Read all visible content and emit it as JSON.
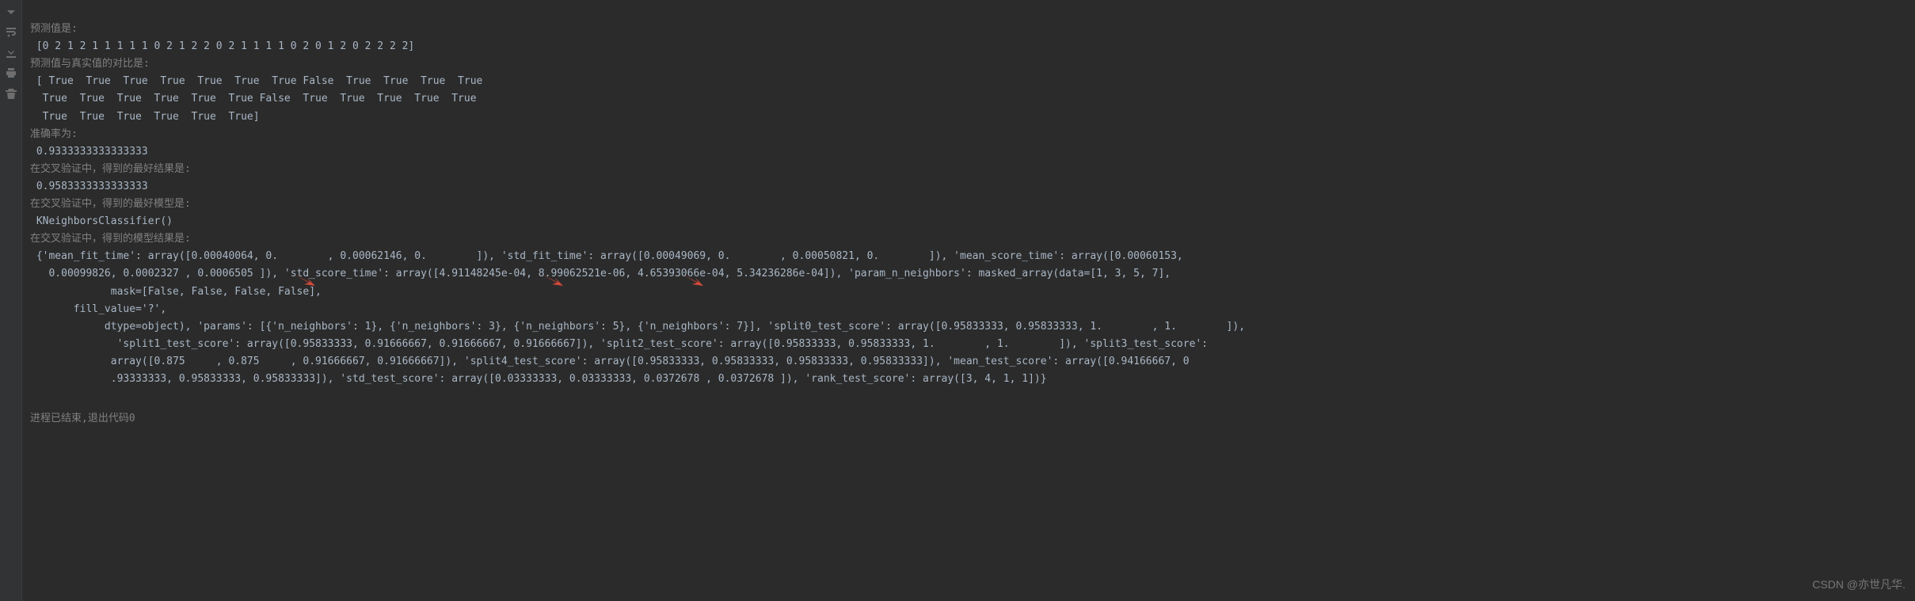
{
  "gutter": {
    "icons": [
      "arrow-down-icon",
      "wrap-icon",
      "download-icon",
      "print-icon",
      "trash-icon"
    ]
  },
  "labels": {
    "pred_header": "预测值是:",
    "pred_values": " [0 2 1 2 1 1 1 1 1 0 2 1 2 2 0 2 1 1 1 1 0 2 0 1 2 0 2 2 2 2]",
    "compare_header": "预测值与真实值的对比是:",
    "compare_row_1": " [ True  True  True  True  True  True  True False  True  True  True  True",
    "compare_row_2": "  True  True  True  True  True  True False  True  True  True  True  True",
    "compare_row_3": "  True  True  True  True  True  True]",
    "accuracy_header": "准确率为:",
    "accuracy_value": " 0.9333333333333333",
    "cv_best_result_header": "在交叉验证中，得到的最好结果是:",
    "cv_best_result_value": " 0.9583333333333333",
    "cv_best_model_header": "在交叉验证中，得到的最好模型是:",
    "cv_best_model_value": " KNeighborsClassifier()",
    "cv_model_results_header": "在交叉验证中，得到的模型结果是:",
    "cv_results_line_1": " {'mean_fit_time': array([0.00040064, 0.        , 0.00062146, 0.        ]), 'std_fit_time': array([0.00049069, 0.        , 0.00050821, 0.        ]), 'mean_score_time': array([0.00060153,",
    "cv_results_line_2": "   0.00099826, 0.0002327 , 0.0006505 ]), 'std_score_time': array([4.91148245e-04, 8.99062521e-06, 4.65393066e-04, 5.34236286e-04]), 'param_n_neighbors': masked_array(data=[1, 3, 5, 7],",
    "cv_results_line_3": "             mask=[False, False, False, False],",
    "cv_results_line_4": "       fill_value='?',",
    "cv_results_line_5": "            dtype=object), 'params': [{'n_neighbors': 1}, {'n_neighbors': 3}, {'n_neighbors': 5}, {'n_neighbors': 7}], 'split0_test_score': array([0.95833333, 0.95833333, 1.        , 1.        ]),",
    "cv_results_line_6": "              'split1_test_score': array([0.95833333, 0.91666667, 0.91666667, 0.91666667]), 'split2_test_score': array([0.95833333, 0.95833333, 1.        , 1.        ]), 'split3_test_score':",
    "cv_results_line_7": "             array([0.875     , 0.875     , 0.91666667, 0.91666667]), 'split4_test_score': array([0.95833333, 0.95833333, 0.95833333, 0.95833333]), 'mean_test_score': array([0.94166667, 0",
    "cv_results_line_8": "             .93333333, 0.95833333, 0.95833333]), 'std_test_score': array([0.03333333, 0.03333333, 0.0372678 , 0.0372678 ]), 'rank_test_score': array([3, 4, 1, 1])}",
    "exit_status": "进程已结束,退出代码0"
  },
  "watermark": "CSDN @亦世凡华.",
  "chart_data": {
    "type": "table",
    "title": "GridSearchCV cv_results_ for KNeighborsClassifier",
    "params": [
      {
        "n_neighbors": 1
      },
      {
        "n_neighbors": 3
      },
      {
        "n_neighbors": 5
      },
      {
        "n_neighbors": 7
      }
    ],
    "mean_fit_time": [
      0.00040064,
      0.0,
      0.00062146,
      0.0
    ],
    "std_fit_time": [
      0.00049069,
      0.0,
      0.00050821,
      0.0
    ],
    "mean_score_time": [
      0.00060153,
      0.00099826,
      0.0002327,
      0.0006505
    ],
    "std_score_time": [
      0.000491148245,
      8.99062521e-06,
      0.000465393066,
      0.000534236286
    ],
    "param_n_neighbors": [
      1,
      3,
      5,
      7
    ],
    "split0_test_score": [
      0.95833333,
      0.95833333,
      1.0,
      1.0
    ],
    "split1_test_score": [
      0.95833333,
      0.91666667,
      0.91666667,
      0.91666667
    ],
    "split2_test_score": [
      0.95833333,
      0.95833333,
      1.0,
      1.0
    ],
    "split3_test_score": [
      0.875,
      0.875,
      0.91666667,
      0.91666667
    ],
    "split4_test_score": [
      0.95833333,
      0.95833333,
      0.95833333,
      0.95833333
    ],
    "mean_test_score": [
      0.94166667,
      0.93333333,
      0.95833333,
      0.95833333
    ],
    "std_test_score": [
      0.03333333,
      0.03333333,
      0.0372678,
      0.0372678
    ],
    "rank_test_score": [
      3,
      4,
      1,
      1
    ],
    "predictions": [
      0,
      2,
      1,
      2,
      1,
      1,
      1,
      1,
      1,
      0,
      2,
      1,
      2,
      2,
      0,
      2,
      1,
      1,
      1,
      1,
      0,
      2,
      0,
      1,
      2,
      0,
      2,
      2,
      2,
      2
    ],
    "pred_match": [
      true,
      true,
      true,
      true,
      true,
      true,
      true,
      false,
      true,
      true,
      true,
      true,
      true,
      true,
      true,
      true,
      true,
      true,
      false,
      true,
      true,
      true,
      true,
      true,
      true,
      true,
      true,
      true,
      true,
      true
    ],
    "accuracy": 0.9333333333333333,
    "best_cv_score": 0.9583333333333333,
    "best_model": "KNeighborsClassifier()"
  }
}
